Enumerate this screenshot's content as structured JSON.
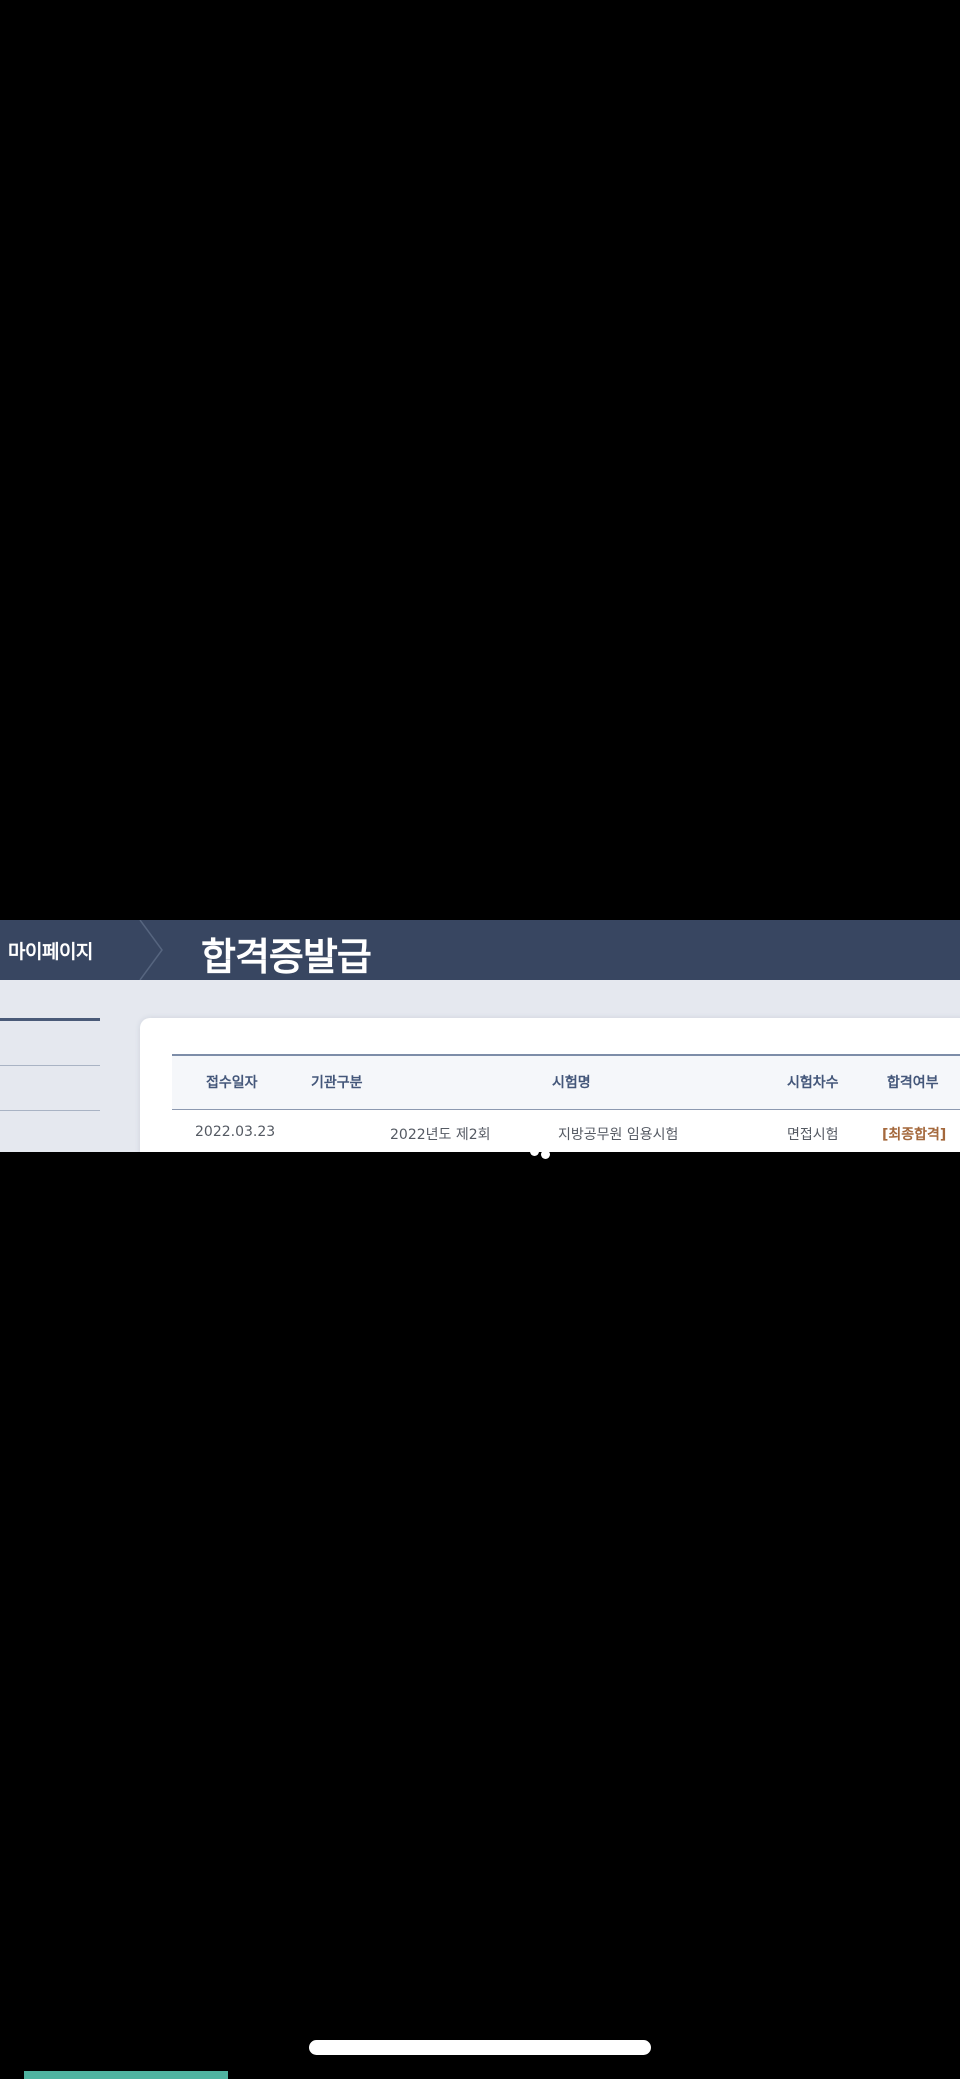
{
  "header": {
    "breadcrumb": "마이페이지",
    "title": "합격증발급"
  },
  "table": {
    "columns": [
      "접수일자",
      "기관구분",
      "시험명",
      "시험차수",
      "합격여부"
    ],
    "rows": [
      {
        "date": "2022.03.23",
        "agency": "2022년도 제2회",
        "exam": "지방공무원 임용시험",
        "round": "면접시험",
        "result": "[최종합격]"
      }
    ]
  },
  "colors": {
    "header_bg": "#384661",
    "accent_result": "#a4683c",
    "bottom_bar": "#4fb3a0"
  }
}
